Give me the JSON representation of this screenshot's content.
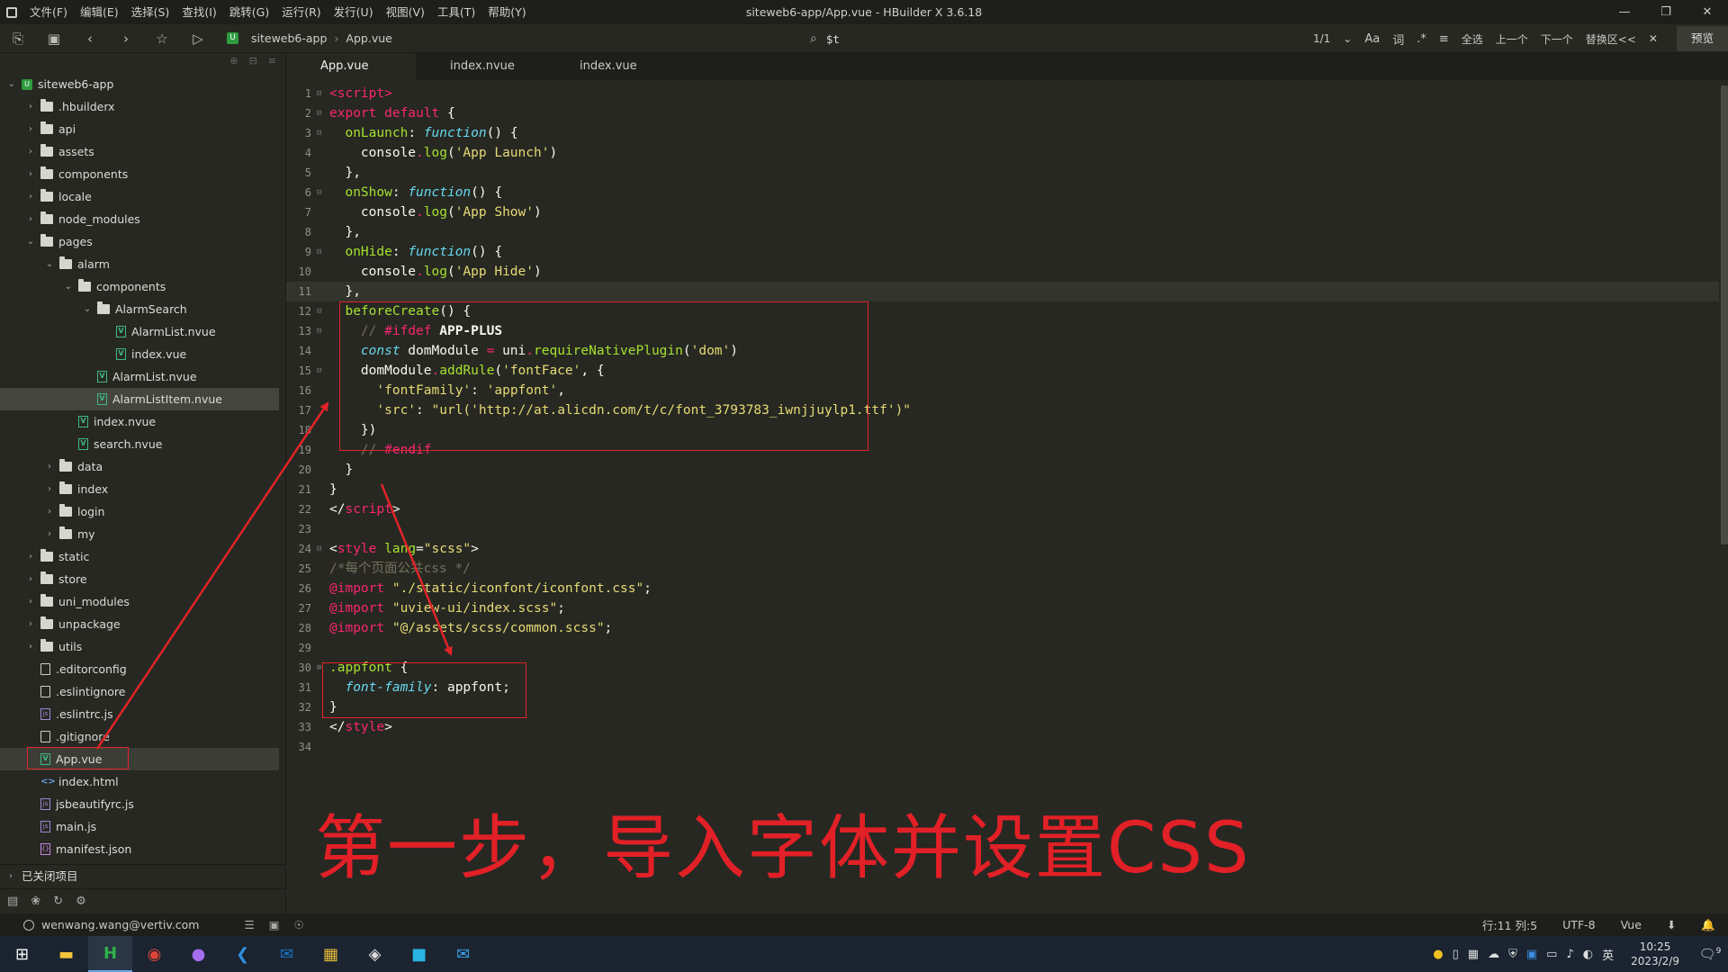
{
  "titlebar": {
    "title": "siteweb6-app/App.vue - HBuilder X 3.6.18",
    "menus": [
      "文件(F)",
      "编辑(E)",
      "选择(S)",
      "查找(I)",
      "跳转(G)",
      "运行(R)",
      "发行(U)",
      "视图(V)",
      "工具(T)",
      "帮助(Y)"
    ],
    "controls": {
      "minimize": "—",
      "restore": "❐",
      "close": "✕"
    }
  },
  "toolbar": {
    "breadcrumb": {
      "project": "siteweb6-app",
      "file": "App.vue",
      "project_icon": "U"
    },
    "search_value": "$t",
    "find_count": "1/1",
    "find_chev": "⌄",
    "find_case": "Aa",
    "find_word": "词",
    "find_regex": ".*",
    "find_select_all": "全选",
    "find_prev": "上一个",
    "find_next": "下一个",
    "find_replace": "替换区<<",
    "find_close": "✕",
    "preview": "预览"
  },
  "sidebar": {
    "tree": [
      {
        "label": "siteweb6-app",
        "depth": 0,
        "type": "proj",
        "open": true
      },
      {
        "label": ".hbuilderx",
        "depth": 1,
        "type": "folder",
        "open": false
      },
      {
        "label": "api",
        "depth": 1,
        "type": "folder",
        "open": false
      },
      {
        "label": "assets",
        "depth": 1,
        "type": "folder",
        "open": false
      },
      {
        "label": "components",
        "depth": 1,
        "type": "folder",
        "open": false
      },
      {
        "label": "locale",
        "depth": 1,
        "type": "folder",
        "open": false
      },
      {
        "label": "node_modules",
        "depth": 1,
        "type": "folder",
        "open": false
      },
      {
        "label": "pages",
        "depth": 1,
        "type": "folder",
        "open": true
      },
      {
        "label": "alarm",
        "depth": 2,
        "type": "folder",
        "open": true
      },
      {
        "label": "components",
        "depth": 3,
        "type": "folder",
        "open": true
      },
      {
        "label": "AlarmSearch",
        "depth": 4,
        "type": "folder",
        "open": true
      },
      {
        "label": "AlarmList.nvue",
        "depth": 5,
        "type": "vue"
      },
      {
        "label": "index.vue",
        "depth": 5,
        "type": "vue"
      },
      {
        "label": "AlarmList.nvue",
        "depth": 4,
        "type": "vue"
      },
      {
        "label": "AlarmListItem.nvue",
        "depth": 4,
        "type": "vue",
        "selected": true
      },
      {
        "label": "index.nvue",
        "depth": 3,
        "type": "vue"
      },
      {
        "label": "search.nvue",
        "depth": 3,
        "type": "vue"
      },
      {
        "label": "data",
        "depth": 2,
        "type": "folder",
        "open": false
      },
      {
        "label": "index",
        "depth": 2,
        "type": "folder",
        "open": false
      },
      {
        "label": "login",
        "depth": 2,
        "type": "folder",
        "open": false
      },
      {
        "label": "my",
        "depth": 2,
        "type": "folder",
        "open": false
      },
      {
        "label": "static",
        "depth": 1,
        "type": "folder",
        "open": false
      },
      {
        "label": "store",
        "depth": 1,
        "type": "folder",
        "open": false
      },
      {
        "label": "uni_modules",
        "depth": 1,
        "type": "folder",
        "open": false
      },
      {
        "label": "unpackage",
        "depth": 1,
        "type": "folder",
        "open": false
      },
      {
        "label": "utils",
        "depth": 1,
        "type": "folder",
        "open": false
      },
      {
        "label": ".editorconfig",
        "depth": 1,
        "type": "file"
      },
      {
        "label": ".eslintignore",
        "depth": 1,
        "type": "file"
      },
      {
        "label": ".eslintrc.js",
        "depth": 1,
        "type": "js"
      },
      {
        "label": ".gitignore",
        "depth": 1,
        "type": "file"
      },
      {
        "label": "App.vue",
        "depth": 1,
        "type": "vue",
        "highlight": true
      },
      {
        "label": "index.html",
        "depth": 1,
        "type": "html"
      },
      {
        "label": "jsbeautifyrc.js",
        "depth": 1,
        "type": "js"
      },
      {
        "label": "main.js",
        "depth": 1,
        "type": "js"
      },
      {
        "label": "manifest.json",
        "depth": 1,
        "type": "json"
      }
    ],
    "closed_projects": "已关闭项目"
  },
  "editor": {
    "tabs": [
      "App.vue",
      "index.nvue",
      "index.vue"
    ],
    "active_tab": 0,
    "cursor_line": 11
  },
  "annotation": {
    "caption": "第一步，导入字体并设置CSS",
    "color": "#e0242a"
  },
  "statusbar": {
    "account": "wenwang.wang@vertiv.com",
    "position": "行:11  列:5",
    "encoding": "UTF-8",
    "language": "Vue"
  },
  "taskbar": {
    "ime": "英",
    "time": "10:25",
    "date": "2023/2/9",
    "notif_count": "9"
  }
}
